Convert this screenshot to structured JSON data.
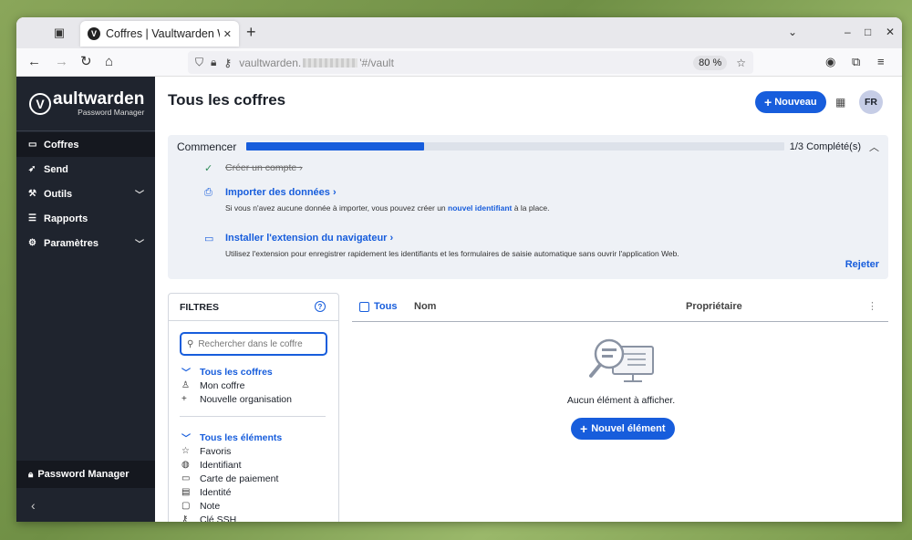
{
  "browser": {
    "tab_title": "Coffres | Vaultwarden We",
    "url_prefix": "vaultwarden.",
    "url_suffix": "'#/vault",
    "zoom": "80 %"
  },
  "sidebar": {
    "logo_title_bold": "V",
    "logo_title_rest": "aultwarden",
    "logo_subtitle": "Password Manager",
    "items": [
      {
        "label": "Coffres"
      },
      {
        "label": "Send"
      },
      {
        "label": "Outils"
      },
      {
        "label": "Rapports"
      },
      {
        "label": "Paramètres"
      }
    ],
    "bottom_label": "Password Manager"
  },
  "header": {
    "title": "Tous les coffres",
    "new_button": "Nouveau",
    "avatar_initials": "FR"
  },
  "onboarding": {
    "title": "Commencer",
    "progress": 0.33,
    "count": "1/3 Complété(s)",
    "items": [
      {
        "title": "Créer un compte",
        "done": true
      },
      {
        "title": "Importer des données",
        "desc_before": "Si vous n'avez aucune donnée à importer, vous pouvez créer un ",
        "desc_link": "nouvel identifiant",
        "desc_after": " à la place."
      },
      {
        "title": "Installer l'extension du navigateur",
        "desc": "Utilisez l'extension pour enregistrer rapidement les identifiants et les formulaires de saisie automatique sans ouvrir l'application Web."
      }
    ],
    "dismiss": "Rejeter"
  },
  "filters": {
    "title": "FILTRES",
    "search_placeholder": "Rechercher dans le coffre",
    "vaults": {
      "title": "Tous les coffres",
      "items": [
        "Mon coffre",
        "Nouvelle organisation"
      ]
    },
    "types": {
      "title": "Tous les éléments",
      "items": [
        "Favoris",
        "Identifiant",
        "Carte de paiement",
        "Identité",
        "Note",
        "Clé SSH"
      ]
    }
  },
  "table": {
    "col_all": "Tous",
    "col_name": "Nom",
    "col_owner": "Propriétaire",
    "empty_text": "Aucun élément à afficher.",
    "new_item_button": "Nouvel élément"
  },
  "colors": {
    "accent": "#175ddc",
    "sidebar_bg": "#1f242e"
  }
}
